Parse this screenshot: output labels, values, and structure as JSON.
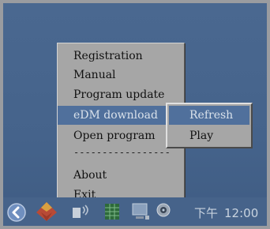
{
  "context_menu": {
    "items": [
      {
        "label": "Registration"
      },
      {
        "label": "Manual"
      },
      {
        "label": "Program update"
      },
      {
        "label": "eDM download"
      },
      {
        "label": "Open program"
      },
      {
        "label": "-----------------"
      },
      {
        "label": "About"
      },
      {
        "label": "Exit"
      }
    ],
    "selected": "eDM download"
  },
  "submenu": {
    "items": [
      {
        "label": "Refresh"
      },
      {
        "label": "Play"
      }
    ],
    "selected": "Refresh"
  },
  "taskbar": {
    "icons": [
      "back-arrow-icon",
      "app-logo-icon",
      "speaker-icon",
      "grid-app-icon",
      "monitor-icon",
      "webcam-icon"
    ],
    "clock": {
      "period": "下午",
      "time": "12:00"
    }
  },
  "colors": {
    "desktop": "#46648a",
    "menu_bg": "#a6a6a6",
    "highlight": "#50709c"
  }
}
